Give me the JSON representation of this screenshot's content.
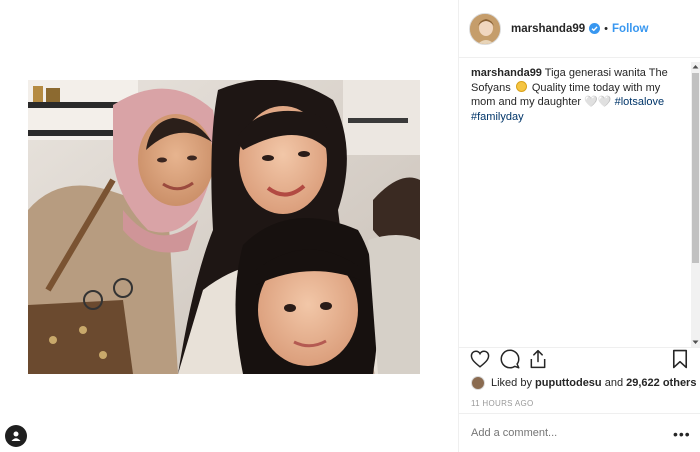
{
  "post": {
    "username": "marshanda99",
    "dot": "•",
    "follow_label": "Follow",
    "caption": {
      "user": "marshanda99",
      "text_1": "Tiga generasi wanita The Sofyans",
      "text_2": "Quality time today with my mom and my daughter",
      "hearts": "🤍🤍",
      "tag_1": "#lotsalove",
      "tag_2": "#familyday"
    },
    "likes": {
      "prefix": "Liked by",
      "user": "puputtodesu",
      "and": "and",
      "count": "29,622 others"
    },
    "timestamp": "11 HOURS AGO",
    "comment_placeholder": "Add a comment...",
    "more_label": "•••"
  },
  "icons": {
    "like": "heart-icon",
    "comment": "comment-icon",
    "share": "share-icon",
    "save": "bookmark-icon",
    "verified": "verified-badge-icon",
    "fab": "person-icon"
  },
  "colors": {
    "accent": "#3897f0",
    "hashtag": "#003569",
    "muted": "#999999",
    "border": "#efefef"
  }
}
